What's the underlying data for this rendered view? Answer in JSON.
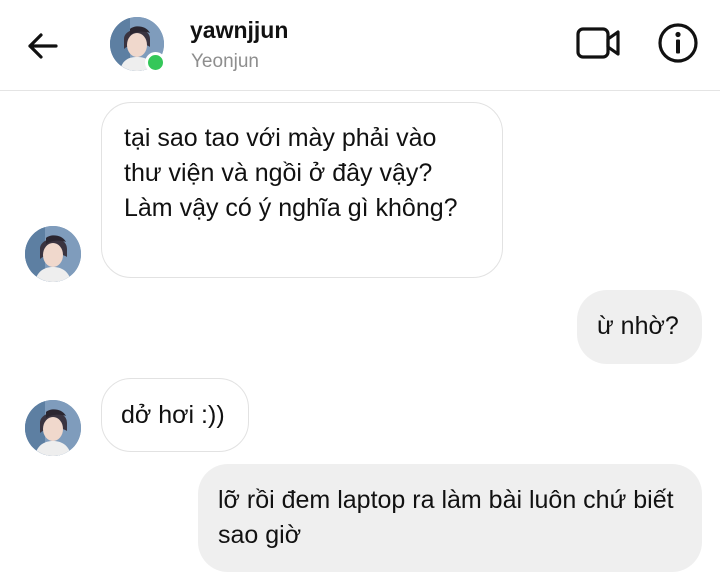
{
  "header": {
    "username": "yawnjjun",
    "display_name": "Yeonjun",
    "back_icon": "arrow-left-icon",
    "video_icon": "video-camera-icon",
    "info_icon": "info-icon",
    "online_color": "#34c759"
  },
  "messages": [
    {
      "sender": "them",
      "text": "tại sao tao với mày phải vào thư viện và ngồi ở đây vậy? Làm vậy có ý nghĩa gì không?"
    },
    {
      "sender": "me",
      "text": "ừ nhờ?"
    },
    {
      "sender": "them",
      "text": "dở hơi :))"
    },
    {
      "sender": "me",
      "text": "lỡ rồi đem laptop ra làm bài luôn chứ biết sao giờ"
    }
  ],
  "colors": {
    "outgoing_bubble": "#efefef",
    "incoming_border": "#e2e2e2",
    "secondary_text": "#8e8e8e"
  }
}
